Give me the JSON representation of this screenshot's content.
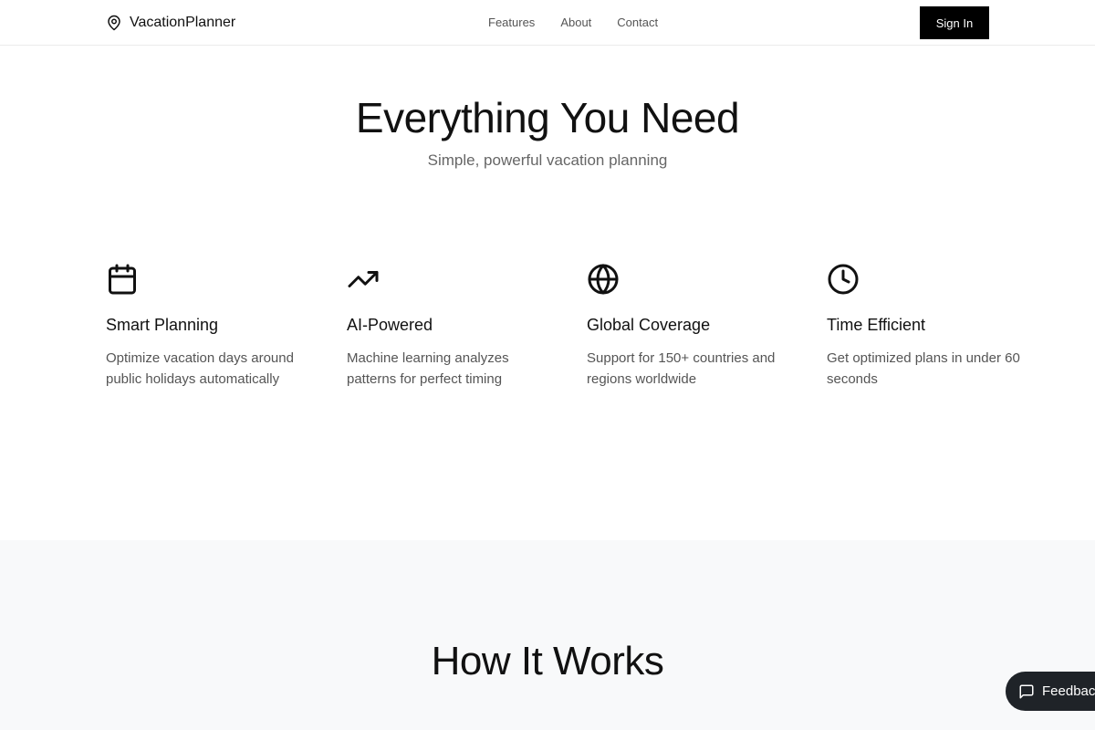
{
  "header": {
    "brand": "VacationPlanner",
    "nav": [
      {
        "label": "Features"
      },
      {
        "label": "About"
      },
      {
        "label": "Contact"
      }
    ],
    "signin_label": "Sign In"
  },
  "hero": {
    "title": "Everything You Need",
    "subtitle": "Simple, powerful vacation planning"
  },
  "features": [
    {
      "icon": "calendar-icon",
      "title": "Smart Planning",
      "description": "Optimize vacation days around public holidays automatically"
    },
    {
      "icon": "trending-up-icon",
      "title": "AI-Powered",
      "description": "Machine learning analyzes patterns for perfect timing"
    },
    {
      "icon": "globe-icon",
      "title": "Global Coverage",
      "description": "Support for 150+ countries and regions worldwide"
    },
    {
      "icon": "clock-icon",
      "title": "Time Efficient",
      "description": "Get optimized plans in under 60 seconds"
    }
  ],
  "how_it_works": {
    "title": "How It Works"
  },
  "feedback": {
    "label": "Feedback"
  },
  "colors": {
    "accent": "#000000",
    "section_bg": "#f8f9fa",
    "feedback_bg": "#1f2328"
  }
}
